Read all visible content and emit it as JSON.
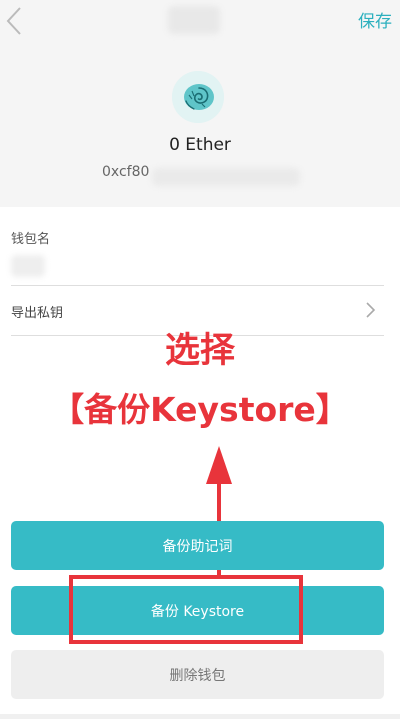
{
  "header": {
    "title": "",
    "save_label": "保存",
    "back_icon": "chevron-left-icon"
  },
  "wallet": {
    "avatar_icon": "nautilus-shell-icon",
    "balance": "0 Ether",
    "address": "0xcf80"
  },
  "form": {
    "wallet_name_label": "钱包名",
    "wallet_name_value": "",
    "export_private_key_label": "导出私钥",
    "export_chevron_icon": "chevron-right-icon"
  },
  "annotation": {
    "line1": "选择",
    "line2": "【备份Keystore】"
  },
  "buttons": {
    "backup_mnemonic": "备份助记词",
    "backup_keystore": "备份 Keystore",
    "delete_wallet": "删除钱包"
  },
  "colors": {
    "accent": "#36bbc6",
    "save_text": "#2cb0be",
    "annotation_red": "#e8343b",
    "header_bg": "#f5f5f5"
  }
}
